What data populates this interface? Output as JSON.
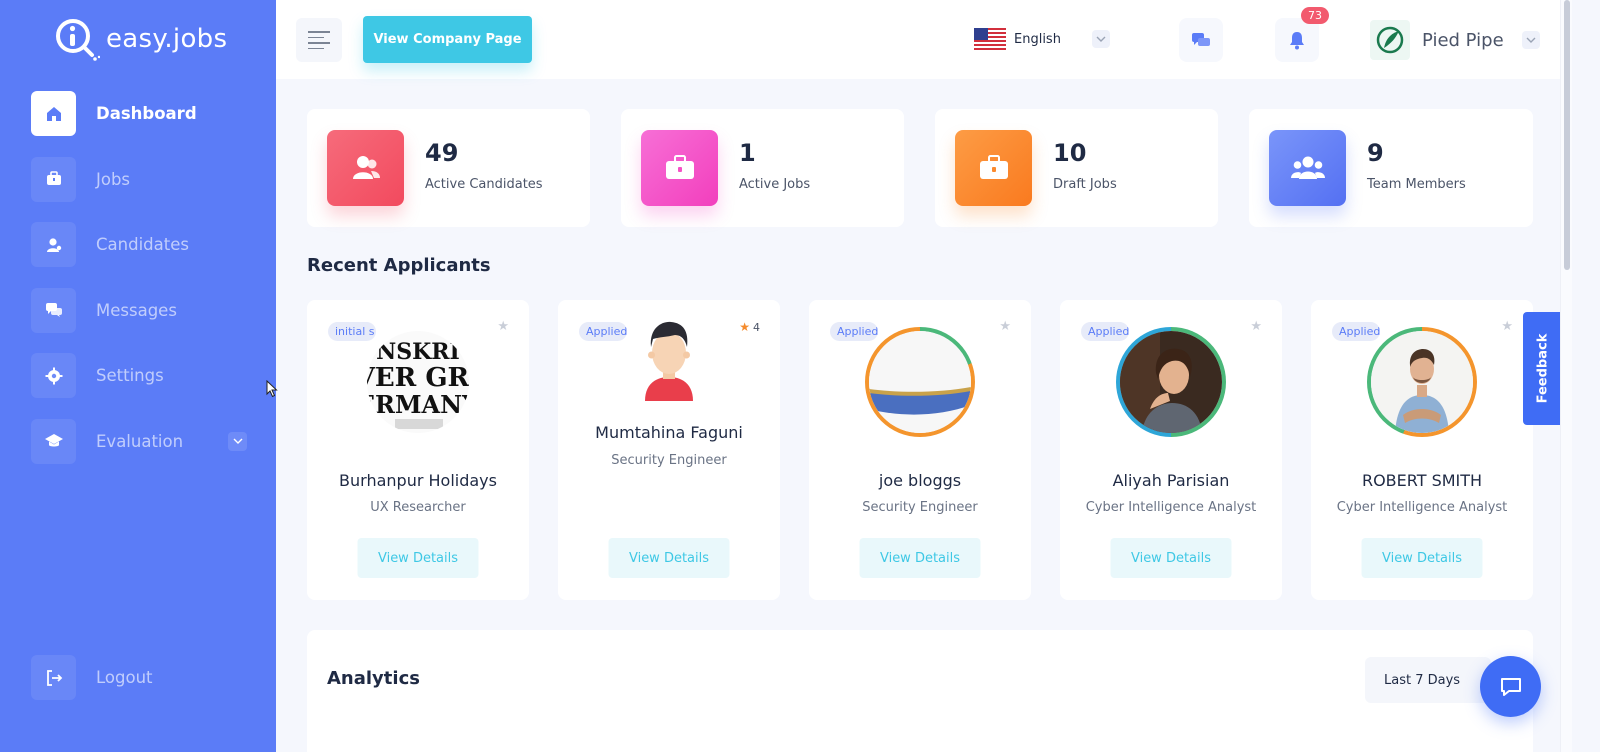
{
  "brand": {
    "name": "easy.jobs"
  },
  "sidebar": {
    "items": [
      {
        "label": "Dashboard",
        "icon": "home-icon",
        "active": true
      },
      {
        "label": "Jobs",
        "icon": "briefcase-icon",
        "active": false
      },
      {
        "label": "Candidates",
        "icon": "user-icon",
        "active": false
      },
      {
        "label": "Messages",
        "icon": "chat-icon",
        "active": false
      },
      {
        "label": "Settings",
        "icon": "gear-icon",
        "active": false
      },
      {
        "label": "Evaluation",
        "icon": "graduation-cap-icon",
        "active": false
      }
    ],
    "logout": "Logout"
  },
  "header": {
    "company_button": "View Company Page",
    "language": "English",
    "notifications_count": "73",
    "company_name": "Pied Pipe"
  },
  "stats": [
    {
      "value": "49",
      "label": "Active Candidates",
      "color": "#f4596b"
    },
    {
      "value": "1",
      "label": "Active Jobs",
      "color": "#f552c6"
    },
    {
      "value": "10",
      "label": "Draft Jobs",
      "color": "#fb8a2e"
    },
    {
      "value": "9",
      "label": "Team Members",
      "color": "#5b7cf7"
    }
  ],
  "recent_applicants": {
    "title": "Recent Applicants",
    "view_label": "View Details",
    "items": [
      {
        "status": "initial s",
        "name": "Burhanpur Holidays",
        "role": "UX Researcher",
        "rating": ""
      },
      {
        "status": "Applied",
        "name": "Mumtahina Faguni",
        "role": "Security Engineer",
        "rating": "4"
      },
      {
        "status": "Applied",
        "name": "joe bloggs",
        "role": "Security Engineer",
        "rating": ""
      },
      {
        "status": "Applied",
        "name": "Aliyah Parisian",
        "role": "Cyber Intelligence Analyst",
        "rating": ""
      },
      {
        "status": "Applied",
        "name": "ROBERT SMITH",
        "role": "Cyber Intelligence Analyst",
        "rating": ""
      }
    ]
  },
  "analytics": {
    "title": "Analytics",
    "period": "Last 7 Days"
  },
  "feedback": "Feedback",
  "colors": {
    "sidebar": "#5b7cf7",
    "accent": "#3ec8e5",
    "primary": "#3f6cf5"
  }
}
